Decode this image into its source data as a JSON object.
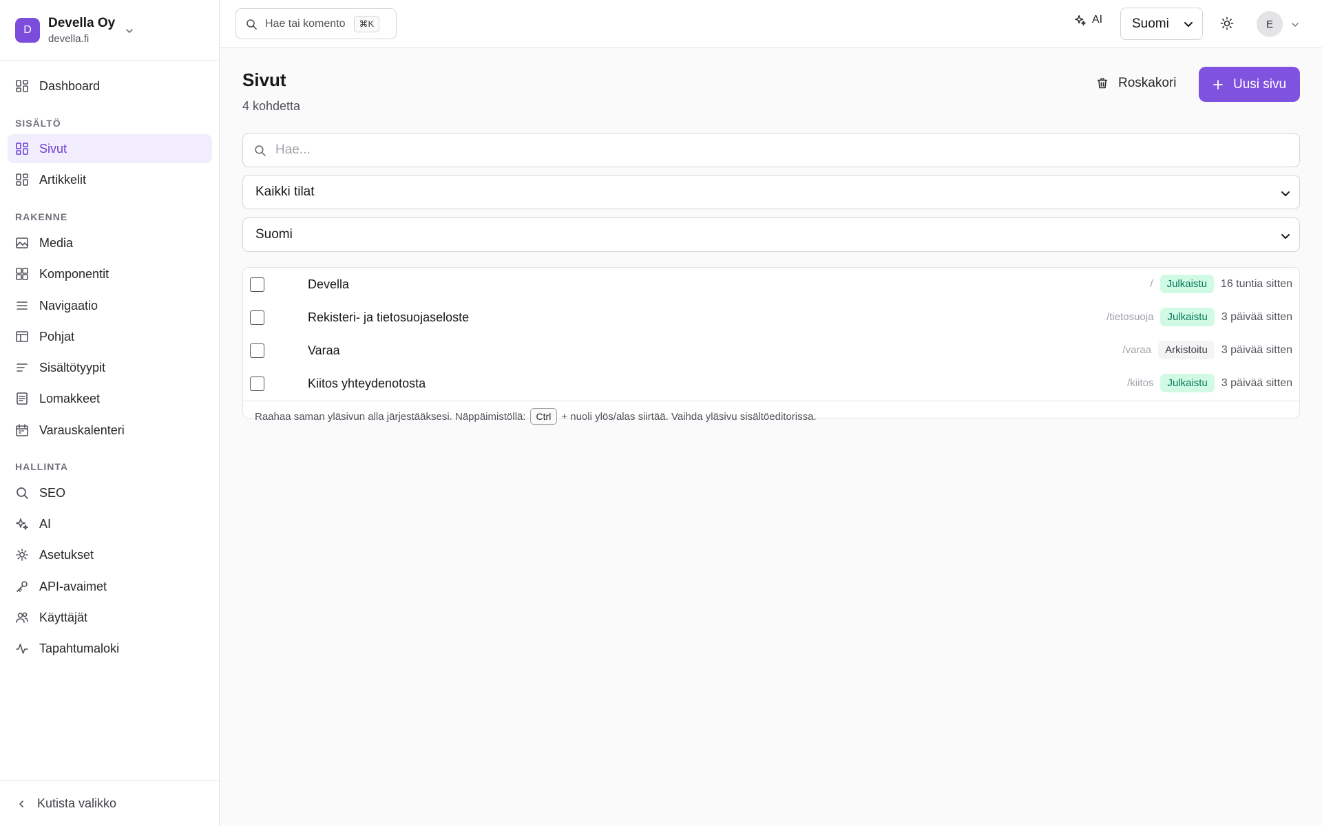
{
  "org": {
    "initial": "D",
    "name": "Devella Oy",
    "domain": "devella.fi"
  },
  "sidebar": {
    "dashboard": "Dashboard",
    "sections": [
      {
        "heading": "SISÄLTÖ",
        "items": [
          {
            "label": "Sivut",
            "icon": "grid-icon"
          },
          {
            "label": "Artikkelit",
            "icon": "grid-icon"
          }
        ]
      },
      {
        "heading": "RAKENNE",
        "items": [
          {
            "label": "Media",
            "icon": "image-icon"
          },
          {
            "label": "Komponentit",
            "icon": "components-icon"
          },
          {
            "label": "Navigaatio",
            "icon": "menu-icon"
          },
          {
            "label": "Pohjat",
            "icon": "layout-icon"
          },
          {
            "label": "Sisältötyypit",
            "icon": "text-lines-icon"
          },
          {
            "label": "Lomakkeet",
            "icon": "form-icon"
          },
          {
            "label": "Varauskalenteri",
            "icon": "calendar-icon"
          }
        ]
      },
      {
        "heading": "HALLINTA",
        "items": [
          {
            "label": "SEO",
            "icon": "search-icon"
          },
          {
            "label": "AI",
            "icon": "sparkles-icon"
          },
          {
            "label": "Asetukset",
            "icon": "gear-icon"
          },
          {
            "label": "API-avaimet",
            "icon": "key-icon"
          },
          {
            "label": "Käyttäjät",
            "icon": "users-icon"
          },
          {
            "label": "Tapahtumaloki",
            "icon": "activity-icon"
          }
        ]
      }
    ],
    "collapse": "Kutista valikko"
  },
  "topbar": {
    "search_placeholder": "Hae tai komento",
    "shortcut": "⌘K",
    "ai": "AI",
    "language": "Suomi",
    "user_initial": "E"
  },
  "page": {
    "title": "Sivut",
    "count": "4 kohdetta",
    "trash": "Roskakori",
    "new_page": "Uusi sivu",
    "search_placeholder": "Hae...",
    "status_filter": "Kaikki tilat",
    "language_filter": "Suomi"
  },
  "rows": [
    {
      "title": "Devella",
      "slug": "/",
      "status": "Julkaistu",
      "time": "16 tuntia sitten"
    },
    {
      "title": "Rekisteri- ja tietosuojaseloste",
      "slug": "/tietosuoja",
      "status": "Julkaistu",
      "time": "3 päivää sitten"
    },
    {
      "title": "Varaa",
      "slug": "/varaa",
      "status": "Arkistoitu",
      "time": "3 päivää sitten"
    },
    {
      "title": "Kiitos yhteydenotosta",
      "slug": "/kiitos",
      "status": "Julkaistu",
      "time": "3 päivää sitten"
    }
  ],
  "footer": {
    "before": "Raahaa saman yläsivun alla järjestääksesi. Näppäimistöllä:",
    "key": "Ctrl",
    "after": "+ nuoli ylös/alas siirtää. Vaihda yläsivu sisältöeditorissa."
  },
  "colors": {
    "accent": "#8052e0",
    "published_bg": "#d1fae5",
    "published_text": "#047857"
  }
}
